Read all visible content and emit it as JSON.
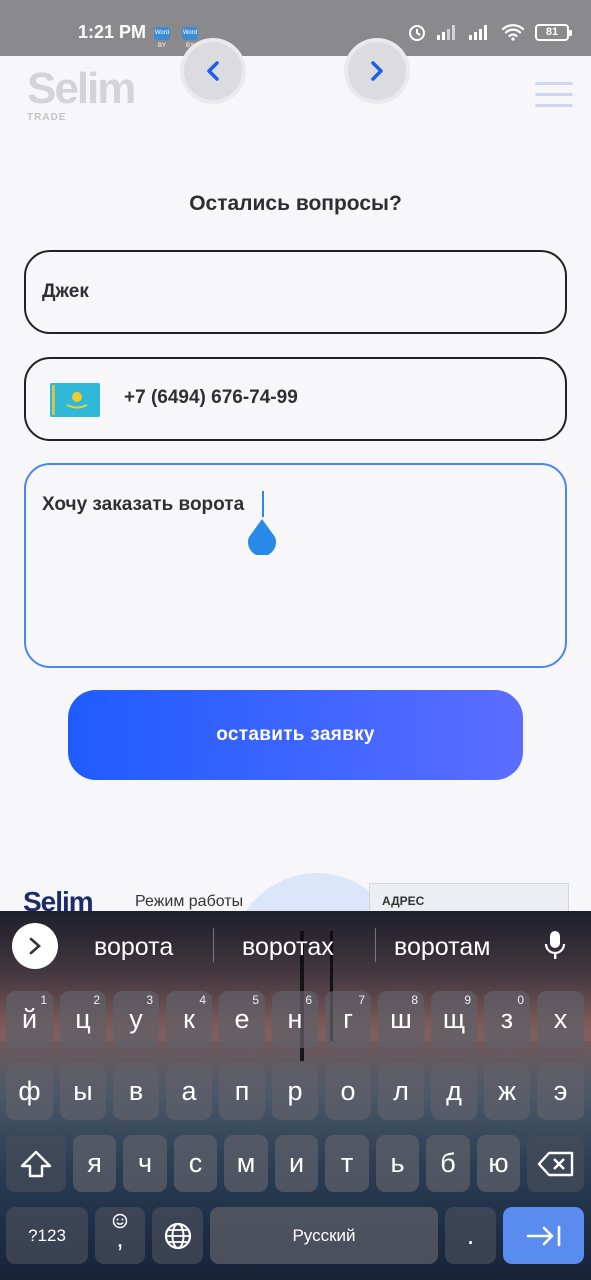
{
  "status_bar": {
    "time": "1:21 PM",
    "mini_icons": [
      "Word BY",
      "Word BY"
    ],
    "battery": "81",
    "icons": [
      "alarm-icon",
      "signal-icon",
      "signal-icon",
      "wifi-icon"
    ]
  },
  "header": {
    "logo_word": "Selim",
    "logo_sub": "TRADE",
    "nav_prev_icon": "chevron-left-icon",
    "nav_next_icon": "chevron-right-icon",
    "menu_icon": "hamburger-icon"
  },
  "form": {
    "title": "Остались вопросы?",
    "name_value": "Джек",
    "phone_flag": "kazakhstan-flag-icon",
    "phone_value": "+7 (6494) 676-74-99",
    "message_value": "Хочу заказать ворота",
    "submit_label": "оставить заявку"
  },
  "footer": {
    "logo_word": "Selim",
    "hours_label": "Режим работы",
    "address_label": "АДРЕС"
  },
  "keyboard": {
    "suggestions": [
      "ворота",
      "воротах",
      "воротам"
    ],
    "row1": [
      {
        "k": "й",
        "n": "1"
      },
      {
        "k": "ц",
        "n": "2"
      },
      {
        "k": "у",
        "n": "3"
      },
      {
        "k": "к",
        "n": "4"
      },
      {
        "k": "е",
        "n": "5"
      },
      {
        "k": "н",
        "n": "6"
      },
      {
        "k": "г",
        "n": "7"
      },
      {
        "k": "ш",
        "n": "8"
      },
      {
        "k": "щ",
        "n": "9"
      },
      {
        "k": "з",
        "n": "0"
      },
      {
        "k": "х",
        "n": ""
      }
    ],
    "row2": [
      "ф",
      "ы",
      "в",
      "а",
      "п",
      "р",
      "о",
      "л",
      "д",
      "ж",
      "э"
    ],
    "row3": [
      "я",
      "ч",
      "с",
      "м",
      "и",
      "т",
      "ь",
      "б",
      "ю"
    ],
    "symbols_label": "?123",
    "emoji_comma_label": ",",
    "space_label": "Русский",
    "period_label": "."
  }
}
